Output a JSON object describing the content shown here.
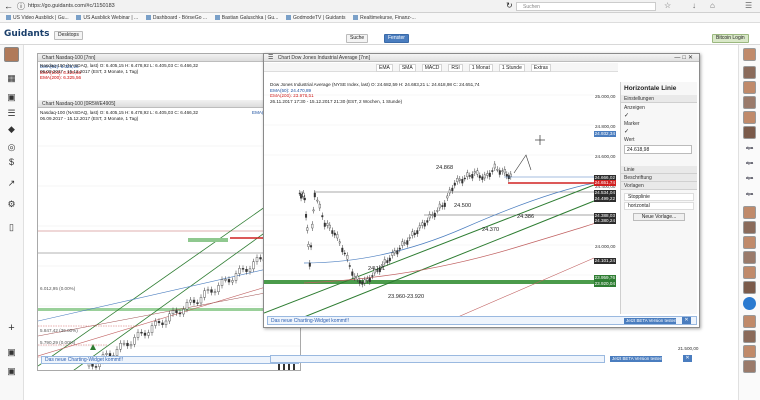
{
  "browser": {
    "url": "https://go.guidants.com/#c/1150183",
    "search_placeholder": "Suchen",
    "bookmarks": [
      "US Video Ausblick | Gu...",
      "US Ausblick Webinar | ...",
      "Dashboard - BörseGo ...",
      "Bastian Galuschka | Gu...",
      "GodmodeTV | Guidants",
      "Realtimekurse, Finanz-..."
    ]
  },
  "app": {
    "logo": "Guidants",
    "search_label": "Suche",
    "window_label": "Fenster",
    "desktop_label": "Desktops",
    "login_label": "Bitcoin Login"
  },
  "nasdaq": {
    "title": "Chart Nasdaq-100 [7nn]",
    "inst": "Nasdaq-100 (NASDAQ, last)  O: 6.405,15  H: 6.478,92  L: 6.405,03  C: 6.466,32",
    "ema50": "EMA(50): 6.353,26",
    "ema100": "EMA(100): 6.325,56",
    "ema200": "EMA(200): 6.325,56",
    "range": "06.09.2017 - 15.12.2017  (EST, 3 Monate, 1 Tag)",
    "ema50_r": "EMA(50): 6.254,7",
    "sub_title": "Chart Nasdaq-100 [0R5WE4905]",
    "sub_inst": "Nasdaq-100 (NASDAQ, last)  O: 6.405,15  H: 6.478,92  L: 6.405,03  C: 6.466,32",
    "sub_range": "06.09.2017 - 15.12.2017  (EST, 3 Monate, 1 Tag)",
    "lvl1": "6.012,95 (0.00%)",
    "lvl2": "5.847,42 (36.00%)",
    "lvl3": "5.790,29 (0.00%)",
    "note": "Das neue Charting-Widget kommt!!",
    "beta": "Jetzt BETA Version testen",
    "axis_bottom": "21.500,00"
  },
  "dow": {
    "title": "Chart Dow Jones Industrial Average [7nn]",
    "toolbar": [
      "EMA",
      "SMA",
      "MACD",
      "RSI",
      "1 Monat",
      "1 Stunde",
      "Extras"
    ],
    "inst": "Dow Jones Industrial Average (NYSE Index, last)  O: 24.682,59  H: 24.683,21  L: 24.618,98  C: 24.651,74",
    "ema50": "EMA(50): 24.470,89",
    "ema200": "EMA(200): 23.978,51",
    "range": "26.11.2017 17:30 - 15.12.2017 21:30  (EST, 2 Wochen, 1 Stunde)",
    "labels": [
      "24.868",
      "24.500",
      "24.386",
      "24.370",
      "24.101",
      "23.960-23.920"
    ],
    "axis": [
      "25.000,00",
      "24.800,00",
      "24.600,00",
      "24.400,00",
      "24.200,00",
      "24.000,00",
      "23.800,00"
    ],
    "prices": [
      {
        "v": "24.932,34",
        "c": "#4a7dbf"
      },
      {
        "v": "24.666,02",
        "c": "#2d2d2d"
      },
      {
        "v": "24.651,74",
        "c": "#d02020"
      },
      {
        "v": "24.534,04",
        "c": "#2d2d2d"
      },
      {
        "v": "24.499,22",
        "c": "#2d2d2d"
      },
      {
        "v": "24.388,03",
        "c": "#2d2d2d"
      },
      {
        "v": "24.380,24",
        "c": "#2d2d2d"
      },
      {
        "v": "24.101,24",
        "c": "#2d2d2d"
      },
      {
        "v": "23.959,76",
        "c": "#2e7d32"
      },
      {
        "v": "23.920,04",
        "c": "#2e7d32"
      }
    ],
    "note": "Das neue Charting-Widget kommt!!",
    "beta": "Jetzt BETA Version testen"
  },
  "sidebar": {
    "title": "Horizontale Linie",
    "sections": [
      "Einstellungen",
      "Anzeigen",
      "Marker",
      "Wert",
      "Linie",
      "Beschriftung",
      "Vorlagen"
    ],
    "value": "24.618,98",
    "templates": [
      "Stopplinie",
      "horizontal"
    ],
    "new_template": "Neue Vorlage..."
  },
  "colors": {
    "accent": "#4a7dbf",
    "green": "#2e7d32",
    "red": "#c00000"
  }
}
